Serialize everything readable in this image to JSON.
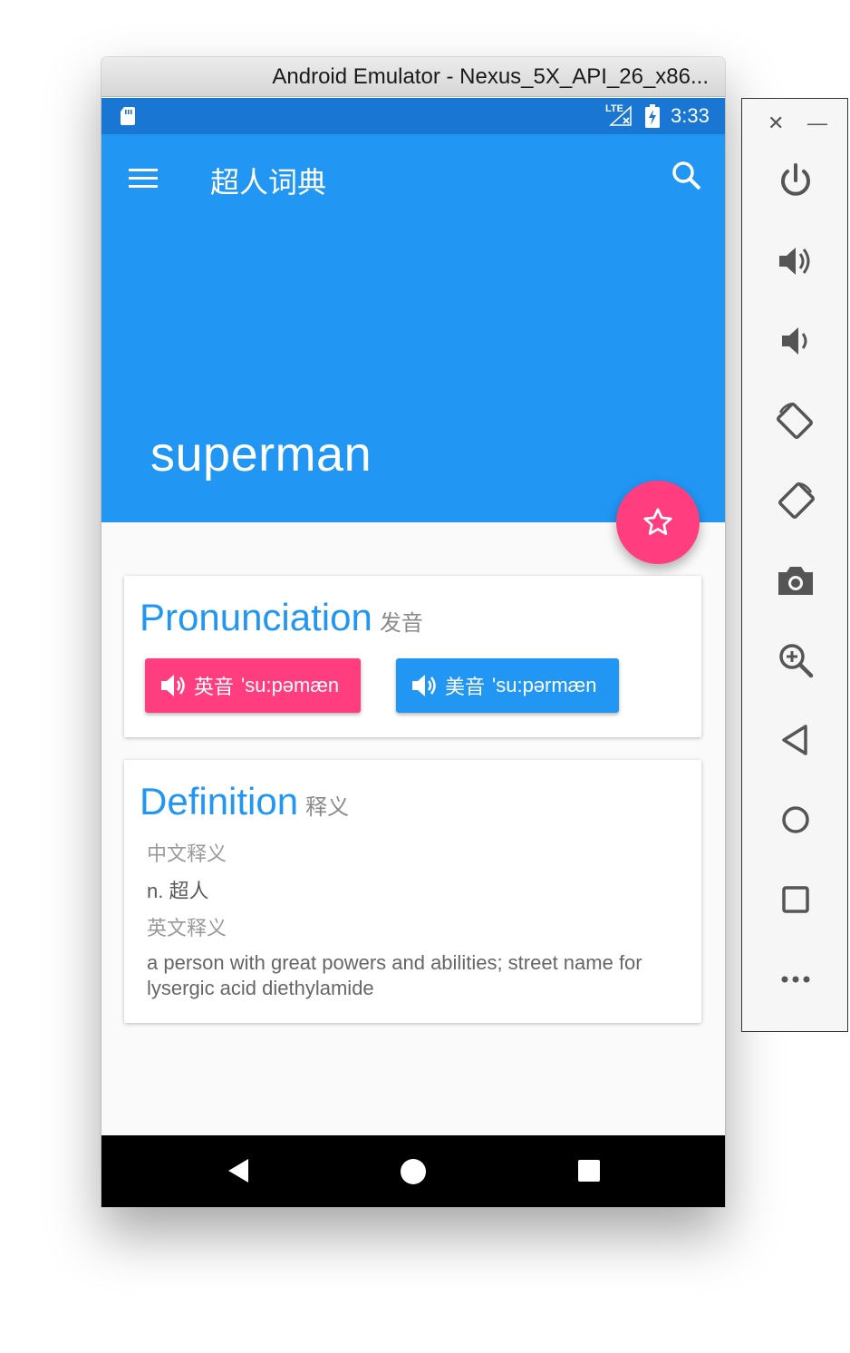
{
  "window": {
    "title": "Android Emulator - Nexus_5X_API_26_x86..."
  },
  "statusbar": {
    "network": "LTE",
    "time": "3:33"
  },
  "appbar": {
    "title": "超人词典",
    "word": "superman"
  },
  "pronunciation": {
    "title": "Pronunciation",
    "subtitle": "发音",
    "uk": {
      "lang": "英音",
      "phonetic": "'su:pəmæn"
    },
    "us": {
      "lang": "美音",
      "phonetic": "'su:pərmæn"
    }
  },
  "definition": {
    "title": "Definition",
    "subtitle": "释义",
    "cn_label": "中文释义",
    "cn_text": "n. 超人",
    "en_label": "英文释义",
    "en_text": "a person with great powers and abilities; street name for lysergic acid diethylamide"
  },
  "colors": {
    "primary": "#2196f3",
    "status": "#1976d2",
    "accent": "#ff3d7f"
  },
  "icons": [
    "menu-icon",
    "search-icon",
    "star-icon",
    "volume-icon",
    "power-icon",
    "volume-up-icon",
    "volume-down-icon",
    "rotate-left-icon",
    "rotate-right-icon",
    "camera-icon",
    "zoom-icon",
    "back-icon",
    "home-icon",
    "overview-icon",
    "more-icon"
  ]
}
